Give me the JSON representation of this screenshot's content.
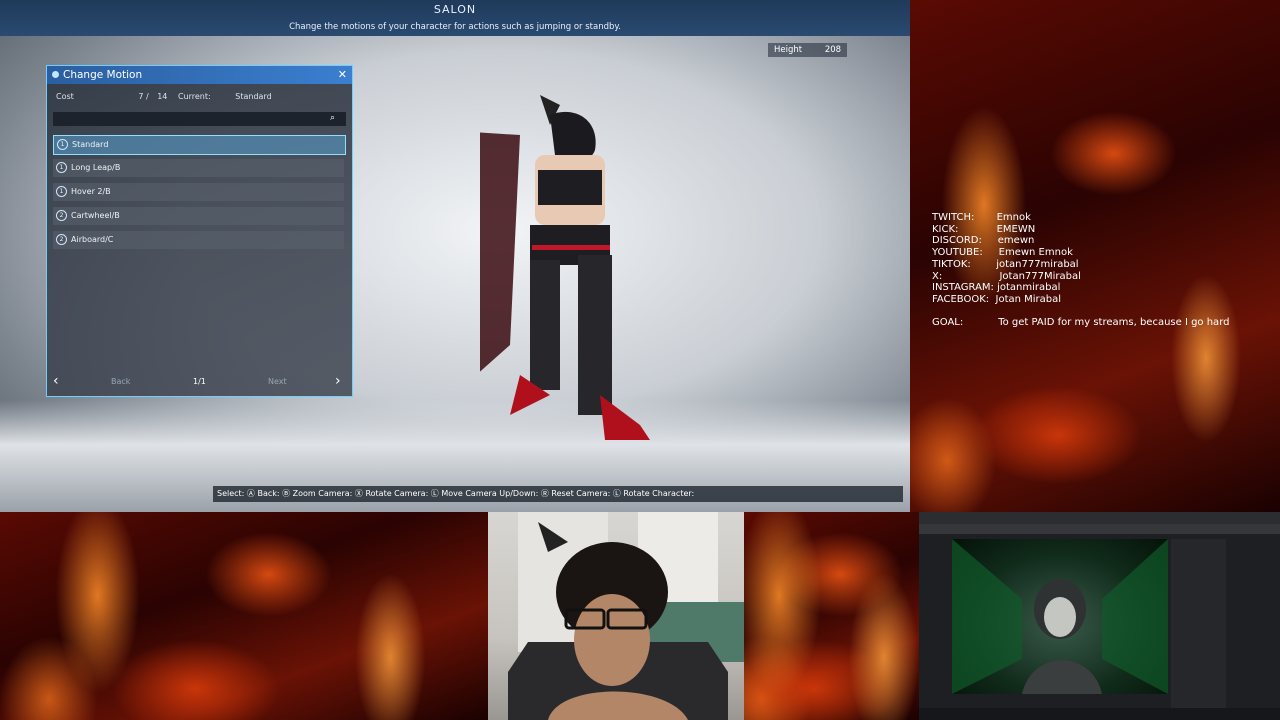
{
  "game": {
    "title": "SALON",
    "subtitle": "Change the motions of your character for actions such as jumping or standby.",
    "height_label": "Height",
    "height_value": "208",
    "panel": {
      "title": "Change Motion",
      "cost_label": "Cost",
      "cost_value": "7 /",
      "cost_max": "14",
      "current_label": "Current:",
      "current_value": "Standard",
      "items": [
        {
          "num": "1",
          "label": "Standard"
        },
        {
          "num": "1",
          "label": "Long Leap/B"
        },
        {
          "num": "1",
          "label": "Hover 2/B"
        },
        {
          "num": "2",
          "label": "Cartwheel/B"
        },
        {
          "num": "2",
          "label": "Airboard/C"
        }
      ],
      "back_label": "Back",
      "page_label": "1/1",
      "next_label": "Next"
    },
    "controls": "Select: Ⓐ Back: Ⓑ Zoom Camera: Ⓧ Rotate Camera: Ⓛ Move Camera Up/Down: Ⓡ Reset Camera: Ⓛ Rotate Character:"
  },
  "socials": [
    {
      "label": "TWITCH:",
      "value": "Emnok"
    },
    {
      "label": "KICK:",
      "value": "EMEWN"
    },
    {
      "label": "DISCORD:",
      "value": "emewn"
    },
    {
      "label": "YOUTUBE:",
      "value": "Emewn Emnok"
    },
    {
      "label": "TIKTOK:",
      "value": "jotan777mirabal"
    },
    {
      "label": "X:",
      "value": "Jotan777Mirabal"
    },
    {
      "label": "INSTAGRAM:",
      "value": "jotanmirabal"
    },
    {
      "label": "FACEBOOK:",
      "value": "Jotan Mirabal"
    }
  ],
  "goal": {
    "label": "GOAL:",
    "value": "To get PAID for my streams, because I go hard"
  }
}
